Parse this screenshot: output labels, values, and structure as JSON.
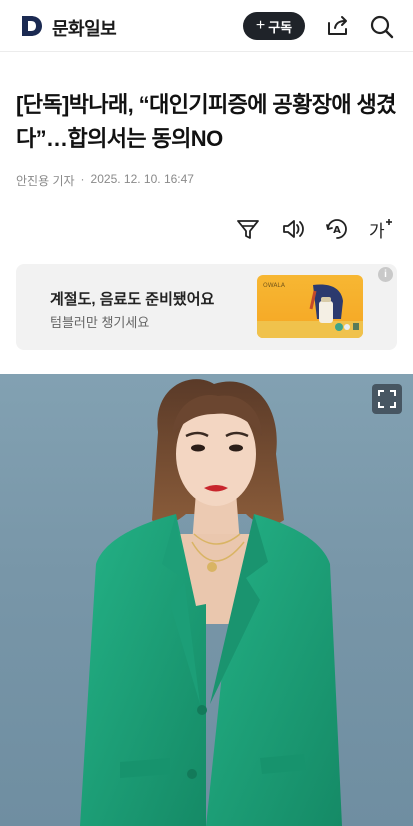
{
  "header": {
    "brand": "문화일보",
    "subscribe_label": "구독",
    "icons": [
      "logo-d-icon",
      "plus-icon",
      "share-icon",
      "search-icon"
    ]
  },
  "article": {
    "headline": "[단독]박나래, “대인기피증에 공황장애 생겼다”…합의서는 동의NO",
    "byline_author": "안진용 기자",
    "byline_sep": "·",
    "byline_date": "2025. 12. 10. 16:47"
  },
  "tools": {
    "icons": [
      "filter-icon",
      "speaker-icon",
      "translate-icon",
      "font-size-icon"
    ]
  },
  "ad": {
    "title": "계절도, 음료도 준비됐어요",
    "subtitle": "텀블러만 챙기세요",
    "info": "i",
    "thumb_brand": "OWALA"
  },
  "colors": {
    "brand_dark": "#1f2329",
    "ad_bg": "#f2f2f2",
    "photo_bg": "#7b99aa",
    "jacket": "#1fa37a"
  }
}
